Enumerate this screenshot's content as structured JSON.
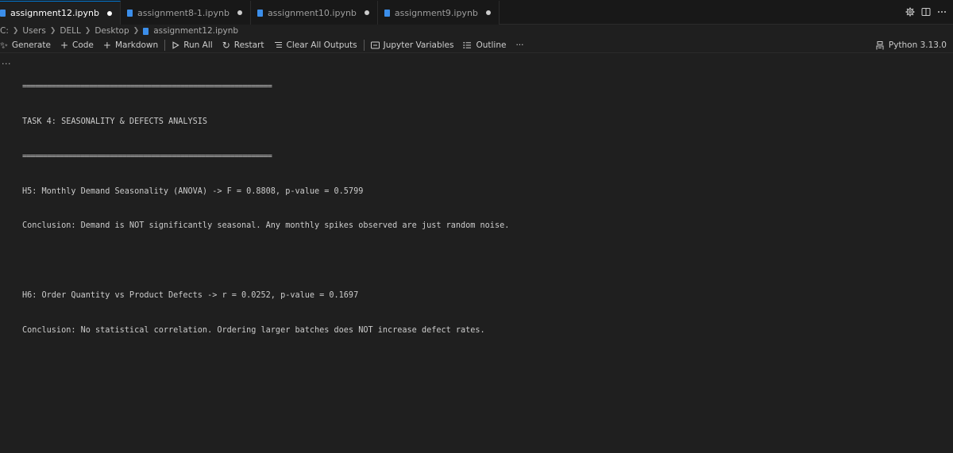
{
  "tabs": [
    {
      "label": "assignment12.ipynb",
      "active": true,
      "modified": true
    },
    {
      "label": "assignment8-1.ipynb",
      "active": false,
      "modified": true
    },
    {
      "label": "assignment10.ipynb",
      "active": false,
      "modified": true
    },
    {
      "label": "assignment9.ipynb",
      "active": false,
      "modified": true
    }
  ],
  "breadcrumb": [
    "C:",
    "Users",
    "DELL",
    "Desktop",
    "assignment12.ipynb"
  ],
  "toolbar": {
    "generate": "Generate",
    "code": "Code",
    "markdown": "Markdown",
    "run_all": "Run All",
    "restart": "Restart",
    "clear_all_outputs": "Clear All Outputs",
    "jupyter_variables": "Jupyter Variables",
    "outline": "Outline",
    "more": "···",
    "kernel": "Python 3.13.0"
  },
  "cell": {
    "more": "···",
    "output_lines": [
      "============================================================",
      "TASK 4: SEASONALITY & DEFECTS ANALYSIS",
      "============================================================",
      "H5: Monthly Demand Seasonality (ANOVA) -> F = 0.8808, p-value = 0.5799",
      "Conclusion: Demand is NOT significantly seasonal. Any monthly spikes observed are just random noise.",
      "",
      "H6: Order Quantity vs Product Defects -> r = 0.0252, p-value = 0.1697",
      "Conclusion: No statistical correlation. Ordering larger batches does NOT increase defect rates."
    ]
  },
  "colors": {
    "accent": "#0078d4",
    "file_icon": "#3b8eea",
    "background": "#1f1f1f",
    "tabbar": "#181818"
  }
}
